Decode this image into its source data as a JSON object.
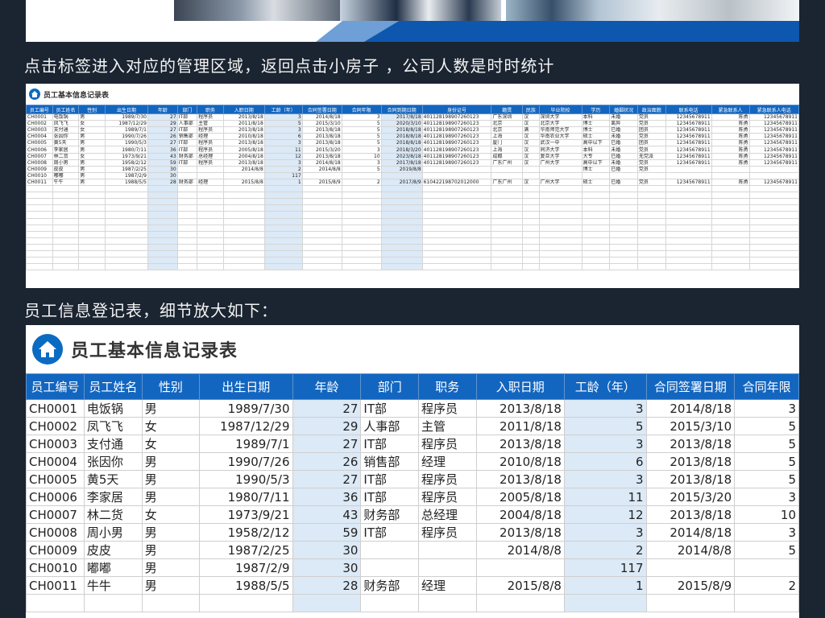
{
  "captions": {
    "top": "点击标签进入对应的管理区域，返回点击小房子 ，公司人数是时时统计",
    "middle": "员工信息登记表，细节放大如下："
  },
  "sheet": {
    "title": "员工基本信息记录表",
    "icon": "house-icon",
    "accent_color": "#1366c0",
    "highlight_color": "#dce9f6",
    "headers": [
      "员工编号",
      "员工姓名",
      "性别",
      "出生日期",
      "年龄",
      "部门",
      "职务",
      "入职日期",
      "工龄（年）",
      "合同签署日期",
      "合同年限",
      "合同到期日期",
      "身份证号",
      "籍贯",
      "民族",
      "毕业院校",
      "学历",
      "婚姻状况",
      "政治面貌",
      "联系电话",
      "紧急联系人",
      "紧急联系人电话"
    ],
    "big_headers": [
      "员工编号",
      "员工姓名",
      "性别",
      "出生日期",
      "年龄",
      "部门",
      "职务",
      "入职日期",
      "工龄（年）",
      "合同签署日期",
      "合同年限"
    ],
    "rows": [
      [
        "CH0001",
        "电饭锅",
        "男",
        "1989/7/30",
        "27",
        "IT部",
        "程序员",
        "2013/8/18",
        "3",
        "2014/8/18",
        "3",
        "2017/8/18",
        "401128198907260123",
        "广东深圳",
        "汉",
        "深圳大学",
        "本科",
        "未婚",
        "党员",
        "12345678911",
        "陈勇",
        "12345678911"
      ],
      [
        "CH0002",
        "凤飞飞",
        "女",
        "1987/12/29",
        "29",
        "人事部",
        "主管",
        "2011/8/18",
        "5",
        "2015/3/10",
        "5",
        "2020/3/10",
        "401128198907260123",
        "北京",
        "汉",
        "北京大学",
        "博士",
        "离异",
        "党员",
        "12345678911",
        "陈勇",
        "12345678911"
      ],
      [
        "CH0003",
        "支付通",
        "女",
        "1989/7/1",
        "27",
        "IT部",
        "程序员",
        "2013/8/18",
        "3",
        "2013/8/18",
        "5",
        "2018/8/18",
        "401128198907260123",
        "北京",
        "满",
        "华南师范大学",
        "博士",
        "已婚",
        "团员",
        "12345678911",
        "陈勇",
        "12345678911"
      ],
      [
        "CH0004",
        "张因你",
        "男",
        "1990/7/26",
        "26",
        "销售部",
        "经理",
        "2010/8/18",
        "6",
        "2013/8/18",
        "5",
        "2018/8/18",
        "401128198907260123",
        "上海",
        "汉",
        "华南农业大学",
        "硕士",
        "未婚",
        "党员",
        "12345678911",
        "陈勇",
        "12345678911"
      ],
      [
        "CH0005",
        "黄5天",
        "男",
        "1990/5/3",
        "27",
        "IT部",
        "程序员",
        "2013/8/18",
        "3",
        "2013/8/18",
        "5",
        "2018/8/18",
        "401128198907260123",
        "厦门",
        "汉",
        "武汉一中",
        "高中以下",
        "已婚",
        "团员",
        "12345678911",
        "陈勇",
        "12345678911"
      ],
      [
        "CH0006",
        "李家居",
        "男",
        "1980/7/11",
        "36",
        "IT部",
        "程序员",
        "2005/8/18",
        "11",
        "2015/3/20",
        "3",
        "2018/3/20",
        "401128198907260123",
        "上海",
        "汉",
        "同济大学",
        "本科",
        "未婚",
        "党员",
        "12345678911",
        "陈勇",
        "12345678911"
      ],
      [
        "CH0007",
        "林二货",
        "女",
        "1973/9/21",
        "43",
        "财务部",
        "总经理",
        "2004/8/18",
        "12",
        "2013/8/18",
        "10",
        "2023/8/18",
        "401128198907260123",
        "成都",
        "汉",
        "复旦大学",
        "大专",
        "已婚",
        "无党派",
        "12345678911",
        "陈勇",
        "12345678911"
      ],
      [
        "CH0008",
        "周小男",
        "男",
        "1958/2/12",
        "59",
        "IT部",
        "程序员",
        "2013/8/18",
        "3",
        "2014/8/18",
        "3",
        "2017/8/18",
        "401128198907260123",
        "广东广州",
        "汉",
        "广州大学",
        "高中以下",
        "未婚",
        "党员",
        "12345678911",
        "陈勇",
        "12345678911"
      ],
      [
        "CH0009",
        "皮皮",
        "男",
        "1987/2/25",
        "30",
        "",
        "",
        "2014/8/8",
        "2",
        "2014/8/8",
        "5",
        "2019/8/8",
        "",
        "",
        "",
        "",
        "博士",
        "已婚",
        "党员",
        "",
        "",
        ""
      ],
      [
        "CH0010",
        "嘟嘟",
        "男",
        "1987/2/9",
        "30",
        "",
        "",
        "",
        "117",
        "",
        "",
        "",
        "",
        "",
        "",
        "",
        "",
        "",
        "",
        "",
        "",
        ""
      ],
      [
        "CH0011",
        "牛牛",
        "男",
        "1988/5/5",
        "28",
        "财务部",
        "经理",
        "2015/8/8",
        "1",
        "2015/8/9",
        "2",
        "2017/8/9",
        "610422198702012000",
        "广东广州",
        "汉",
        "广州大学",
        "硕士",
        "已婚",
        "党员",
        "12345678911",
        "陈勇",
        "12345678911"
      ]
    ]
  }
}
